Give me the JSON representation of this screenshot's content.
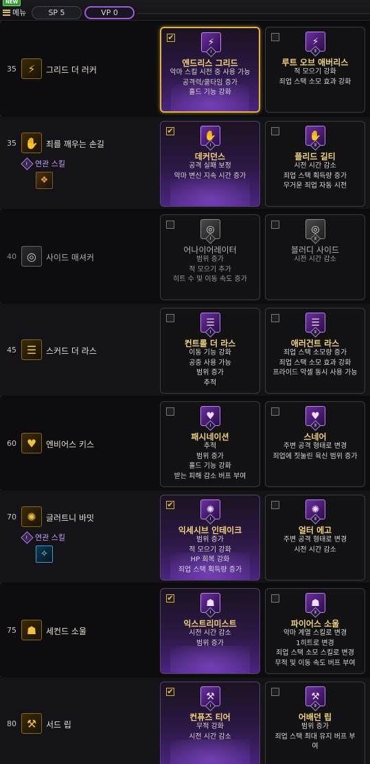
{
  "header": {
    "new_badge": "NEW",
    "menu_label": "메뉴",
    "sp_label": "SP 5",
    "vp_label": "VP 0"
  },
  "related_label": "연관 스킬",
  "rows": [
    {
      "level": "35",
      "name": "그리드 더 러커",
      "icon": "greed-lurker-icon",
      "cards": [
        {
          "checked": true,
          "numeral": "Ⅰ",
          "title": "엔드리스 그리드",
          "lines": [
            "악마 스킬 시전 중 사용 가능",
            "공격력/쿨타임 증가",
            "홀드 기능 강화"
          ]
        },
        {
          "checked": false,
          "numeral": "Ⅱ",
          "title": "루트 오브 애버리스",
          "lines": [
            "적 모으기 강화",
            "죄업 스택 소모 효과 강화"
          ]
        }
      ]
    },
    {
      "level": "35",
      "name": "죄를 깨우는 손길",
      "icon": "sin-hand-icon",
      "related": true,
      "cards": [
        {
          "checked": true,
          "numeral": "Ⅰ",
          "title": "데커던스",
          "lines": [
            "공격 실패 보정",
            "악마 변신 지속 시간 증가"
          ]
        },
        {
          "checked": false,
          "numeral": "Ⅱ",
          "title": "플리드 길티",
          "lines": [
            "시전 시간 감소",
            "죄업 스택 획득량 증가",
            "무거운 죄업 자동 시전"
          ]
        }
      ]
    },
    {
      "level": "40",
      "name": "사이드 매셔커",
      "icon": "side-massacre-icon",
      "cards": [
        {
          "checked": false,
          "numeral": "Ⅰ",
          "title": "어나이어레이터",
          "lines": [
            "범위 증가",
            "적 모으기 추가",
            "히트 수 및 이동 속도 증가"
          ]
        },
        {
          "checked": false,
          "numeral": "Ⅱ",
          "title": "블러디 사이드",
          "lines": [
            "시전 시간 감소"
          ]
        }
      ]
    },
    {
      "level": "45",
      "name": "스커드 더 라스",
      "icon": "scud-wrath-icon",
      "cards": [
        {
          "checked": false,
          "numeral": "Ⅰ",
          "title": "컨트롤 더 라스",
          "lines": [
            "이동 기능 강화",
            "공중 사용 가능",
            "범위 증가",
            "추적"
          ]
        },
        {
          "checked": false,
          "numeral": "Ⅱ",
          "title": "애러건트 라스",
          "lines": [
            "죄업 스택 소모량 증가",
            "죄업 스택 소모 효과 강화",
            "프라이드 악셀 동시 사용 가능"
          ]
        }
      ]
    },
    {
      "level": "60",
      "name": "엔비어스 키스",
      "icon": "envious-kiss-icon",
      "cards": [
        {
          "checked": false,
          "numeral": "Ⅰ",
          "title": "패시네이션",
          "lines": [
            "추적",
            "범위 증가",
            "홀드 기능 강화",
            "받는 피해 감소 버프 부여"
          ]
        },
        {
          "checked": false,
          "numeral": "Ⅱ",
          "title": "스네어",
          "lines": [
            "주변 공격 형태로 변경",
            "죄업에 짓눌린 육신 범위 증가"
          ]
        }
      ]
    },
    {
      "level": "70",
      "name": "글러트니 바밋",
      "icon": "gluttony-vomit-icon",
      "related": true,
      "cards": [
        {
          "checked": true,
          "numeral": "Ⅰ",
          "title": "익세시브 인테이크",
          "lines": [
            "범위 증가",
            "적 모으기 강화",
            "HP 회복 강화",
            "죄업 스택 획득량 증가"
          ]
        },
        {
          "checked": false,
          "numeral": "Ⅱ",
          "title": "얼터 에고",
          "lines": [
            "주변 공격 형태로 변경",
            "시전 시간 감소"
          ]
        }
      ]
    },
    {
      "level": "75",
      "name": "세컨드 소울",
      "icon": "second-soul-icon",
      "cards": [
        {
          "checked": true,
          "numeral": "Ⅰ",
          "title": "익스트리미스트",
          "lines": [
            "시전 시간 감소",
            "범위 증가"
          ]
        },
        {
          "checked": false,
          "numeral": "Ⅱ",
          "title": "파이어스 소울",
          "lines": [
            "악마 계열 스킬로 변경",
            "1히트로 변경",
            "죄업 스택 소모 스킬로 변경",
            "무적 및 이동 속도 버프 부여"
          ]
        }
      ]
    },
    {
      "level": "80",
      "name": "서드 립",
      "icon": "third-rip-icon",
      "cards": [
        {
          "checked": true,
          "numeral": "Ⅰ",
          "title": "컨퓨즈 티어",
          "lines": [
            "무적 강화",
            "시전 시간 감소"
          ]
        },
        {
          "checked": false,
          "numeral": "Ⅱ",
          "title": "어배던 립",
          "lines": [
            "범위 증가",
            "죄업 스택 최대 유지 버프 부",
            "여"
          ]
        }
      ]
    }
  ],
  "colors": {
    "accent_gold": "#e6b23c",
    "accent_purple": "#9a5fe0",
    "title_gold": "#f2d27a"
  }
}
